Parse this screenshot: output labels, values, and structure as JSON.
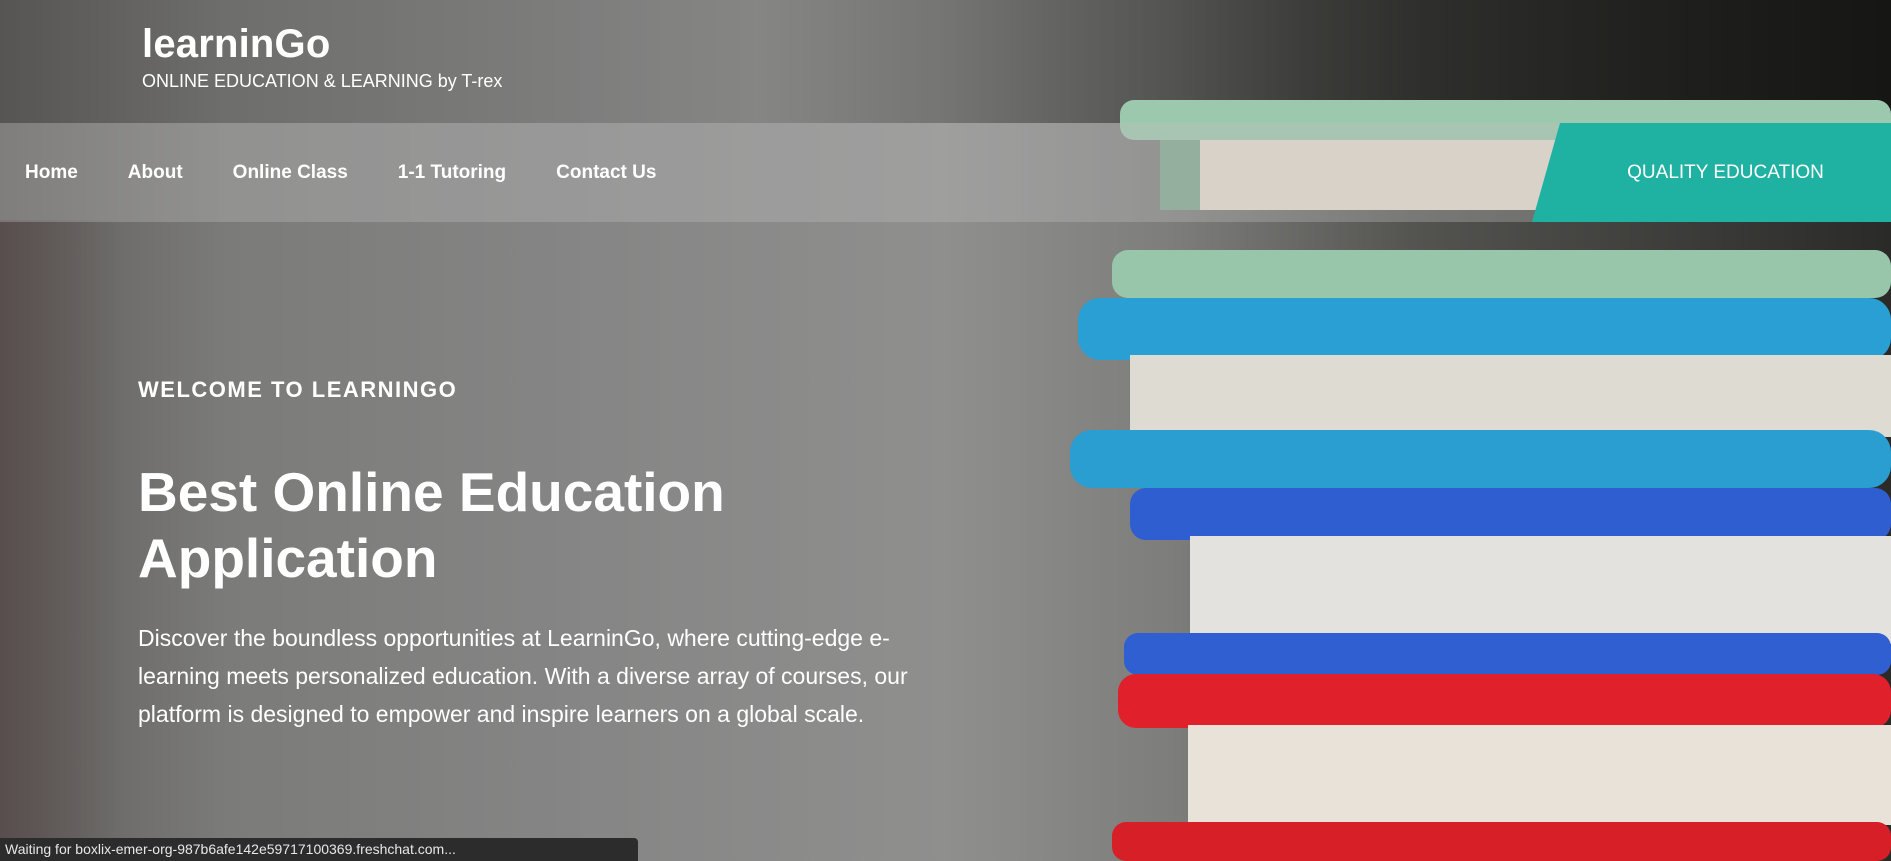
{
  "brand": {
    "title": "learninGo",
    "tagline": "ONLINE EDUCATION & LEARNING by T-rex"
  },
  "nav": {
    "items": [
      {
        "label": "Home"
      },
      {
        "label": "About"
      },
      {
        "label": "Online Class"
      },
      {
        "label": "1-1 Tutoring"
      },
      {
        "label": "Contact Us"
      }
    ],
    "cta_label": "QUALITY EDUCATION"
  },
  "hero": {
    "eyebrow": "WELCOME TO LEARNINGO",
    "heading": "Best Online Education Application",
    "body": "Discover the boundless opportunities at LearninGo, where cutting-edge e-learning meets personalized education. With a diverse array of courses, our platform is designed to empower and inspire learners on a global scale."
  },
  "status_bar": {
    "text": "Waiting for boxlix-emer-org-987b6afe142e59717100369.freshchat.com..."
  },
  "colors": {
    "accent": "#1fb2a2",
    "hero_text": "#ffffff"
  }
}
